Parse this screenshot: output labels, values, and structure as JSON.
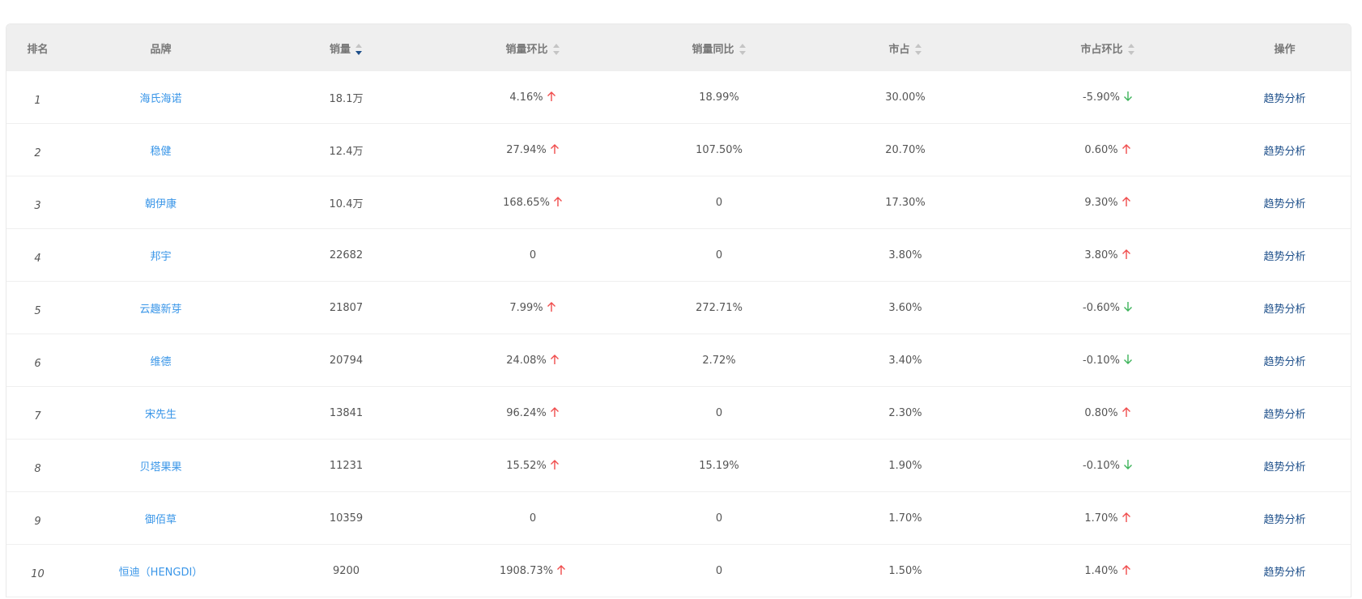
{
  "columns": [
    {
      "key": "rank",
      "label": "排名",
      "sortable": false
    },
    {
      "key": "brand",
      "label": "品牌",
      "sortable": false
    },
    {
      "key": "sales",
      "label": "销量",
      "sortable": true,
      "active": "desc"
    },
    {
      "key": "sales_mom",
      "label": "销量环比",
      "sortable": true
    },
    {
      "key": "sales_yoy",
      "label": "销量同比",
      "sortable": true
    },
    {
      "key": "share",
      "label": "市占",
      "sortable": true
    },
    {
      "key": "share_mom",
      "label": "市占环比",
      "sortable": true
    },
    {
      "key": "action",
      "label": "操作",
      "sortable": false
    }
  ],
  "colors": {
    "up": "#f04c4c",
    "down": "#3db35a",
    "link": "#3a96e8",
    "action": "#1d4f8a",
    "sort_active": "#1d4f8a"
  },
  "rows": [
    {
      "rank": "1",
      "brand": "海氏海诺",
      "sales": "18.1万",
      "sales_mom": "4.16%",
      "sales_mom_dir": "up",
      "sales_yoy": "18.99%",
      "share": "30.00%",
      "share_mom": "-5.90%",
      "share_mom_dir": "down",
      "action": "趋势分析"
    },
    {
      "rank": "2",
      "brand": "稳健",
      "sales": "12.4万",
      "sales_mom": "27.94%",
      "sales_mom_dir": "up",
      "sales_yoy": "107.50%",
      "share": "20.70%",
      "share_mom": "0.60%",
      "share_mom_dir": "up",
      "action": "趋势分析"
    },
    {
      "rank": "3",
      "brand": "朝伊康",
      "sales": "10.4万",
      "sales_mom": "168.65%",
      "sales_mom_dir": "up",
      "sales_yoy": "0",
      "share": "17.30%",
      "share_mom": "9.30%",
      "share_mom_dir": "up",
      "action": "趋势分析"
    },
    {
      "rank": "4",
      "brand": "邦宇",
      "sales": "22682",
      "sales_mom": "0",
      "sales_mom_dir": "",
      "sales_yoy": "0",
      "share": "3.80%",
      "share_mom": "3.80%",
      "share_mom_dir": "up",
      "action": "趋势分析"
    },
    {
      "rank": "5",
      "brand": "云趣新芽",
      "sales": "21807",
      "sales_mom": "7.99%",
      "sales_mom_dir": "up",
      "sales_yoy": "272.71%",
      "share": "3.60%",
      "share_mom": "-0.60%",
      "share_mom_dir": "down",
      "action": "趋势分析"
    },
    {
      "rank": "6",
      "brand": "维德",
      "sales": "20794",
      "sales_mom": "24.08%",
      "sales_mom_dir": "up",
      "sales_yoy": "2.72%",
      "share": "3.40%",
      "share_mom": "-0.10%",
      "share_mom_dir": "down",
      "action": "趋势分析"
    },
    {
      "rank": "7",
      "brand": "宋先生",
      "sales": "13841",
      "sales_mom": "96.24%",
      "sales_mom_dir": "up",
      "sales_yoy": "0",
      "share": "2.30%",
      "share_mom": "0.80%",
      "share_mom_dir": "up",
      "action": "趋势分析"
    },
    {
      "rank": "8",
      "brand": "贝塔果果",
      "sales": "11231",
      "sales_mom": "15.52%",
      "sales_mom_dir": "up",
      "sales_yoy": "15.19%",
      "share": "1.90%",
      "share_mom": "-0.10%",
      "share_mom_dir": "down",
      "action": "趋势分析"
    },
    {
      "rank": "9",
      "brand": "御佰草",
      "sales": "10359",
      "sales_mom": "0",
      "sales_mom_dir": "",
      "sales_yoy": "0",
      "share": "1.70%",
      "share_mom": "1.70%",
      "share_mom_dir": "up",
      "action": "趋势分析"
    },
    {
      "rank": "10",
      "brand": "恒迪（HENGDI）",
      "sales": "9200",
      "sales_mom": "1908.73%",
      "sales_mom_dir": "up",
      "sales_yoy": "0",
      "share": "1.50%",
      "share_mom": "1.40%",
      "share_mom_dir": "up",
      "action": "趋势分析"
    }
  ]
}
